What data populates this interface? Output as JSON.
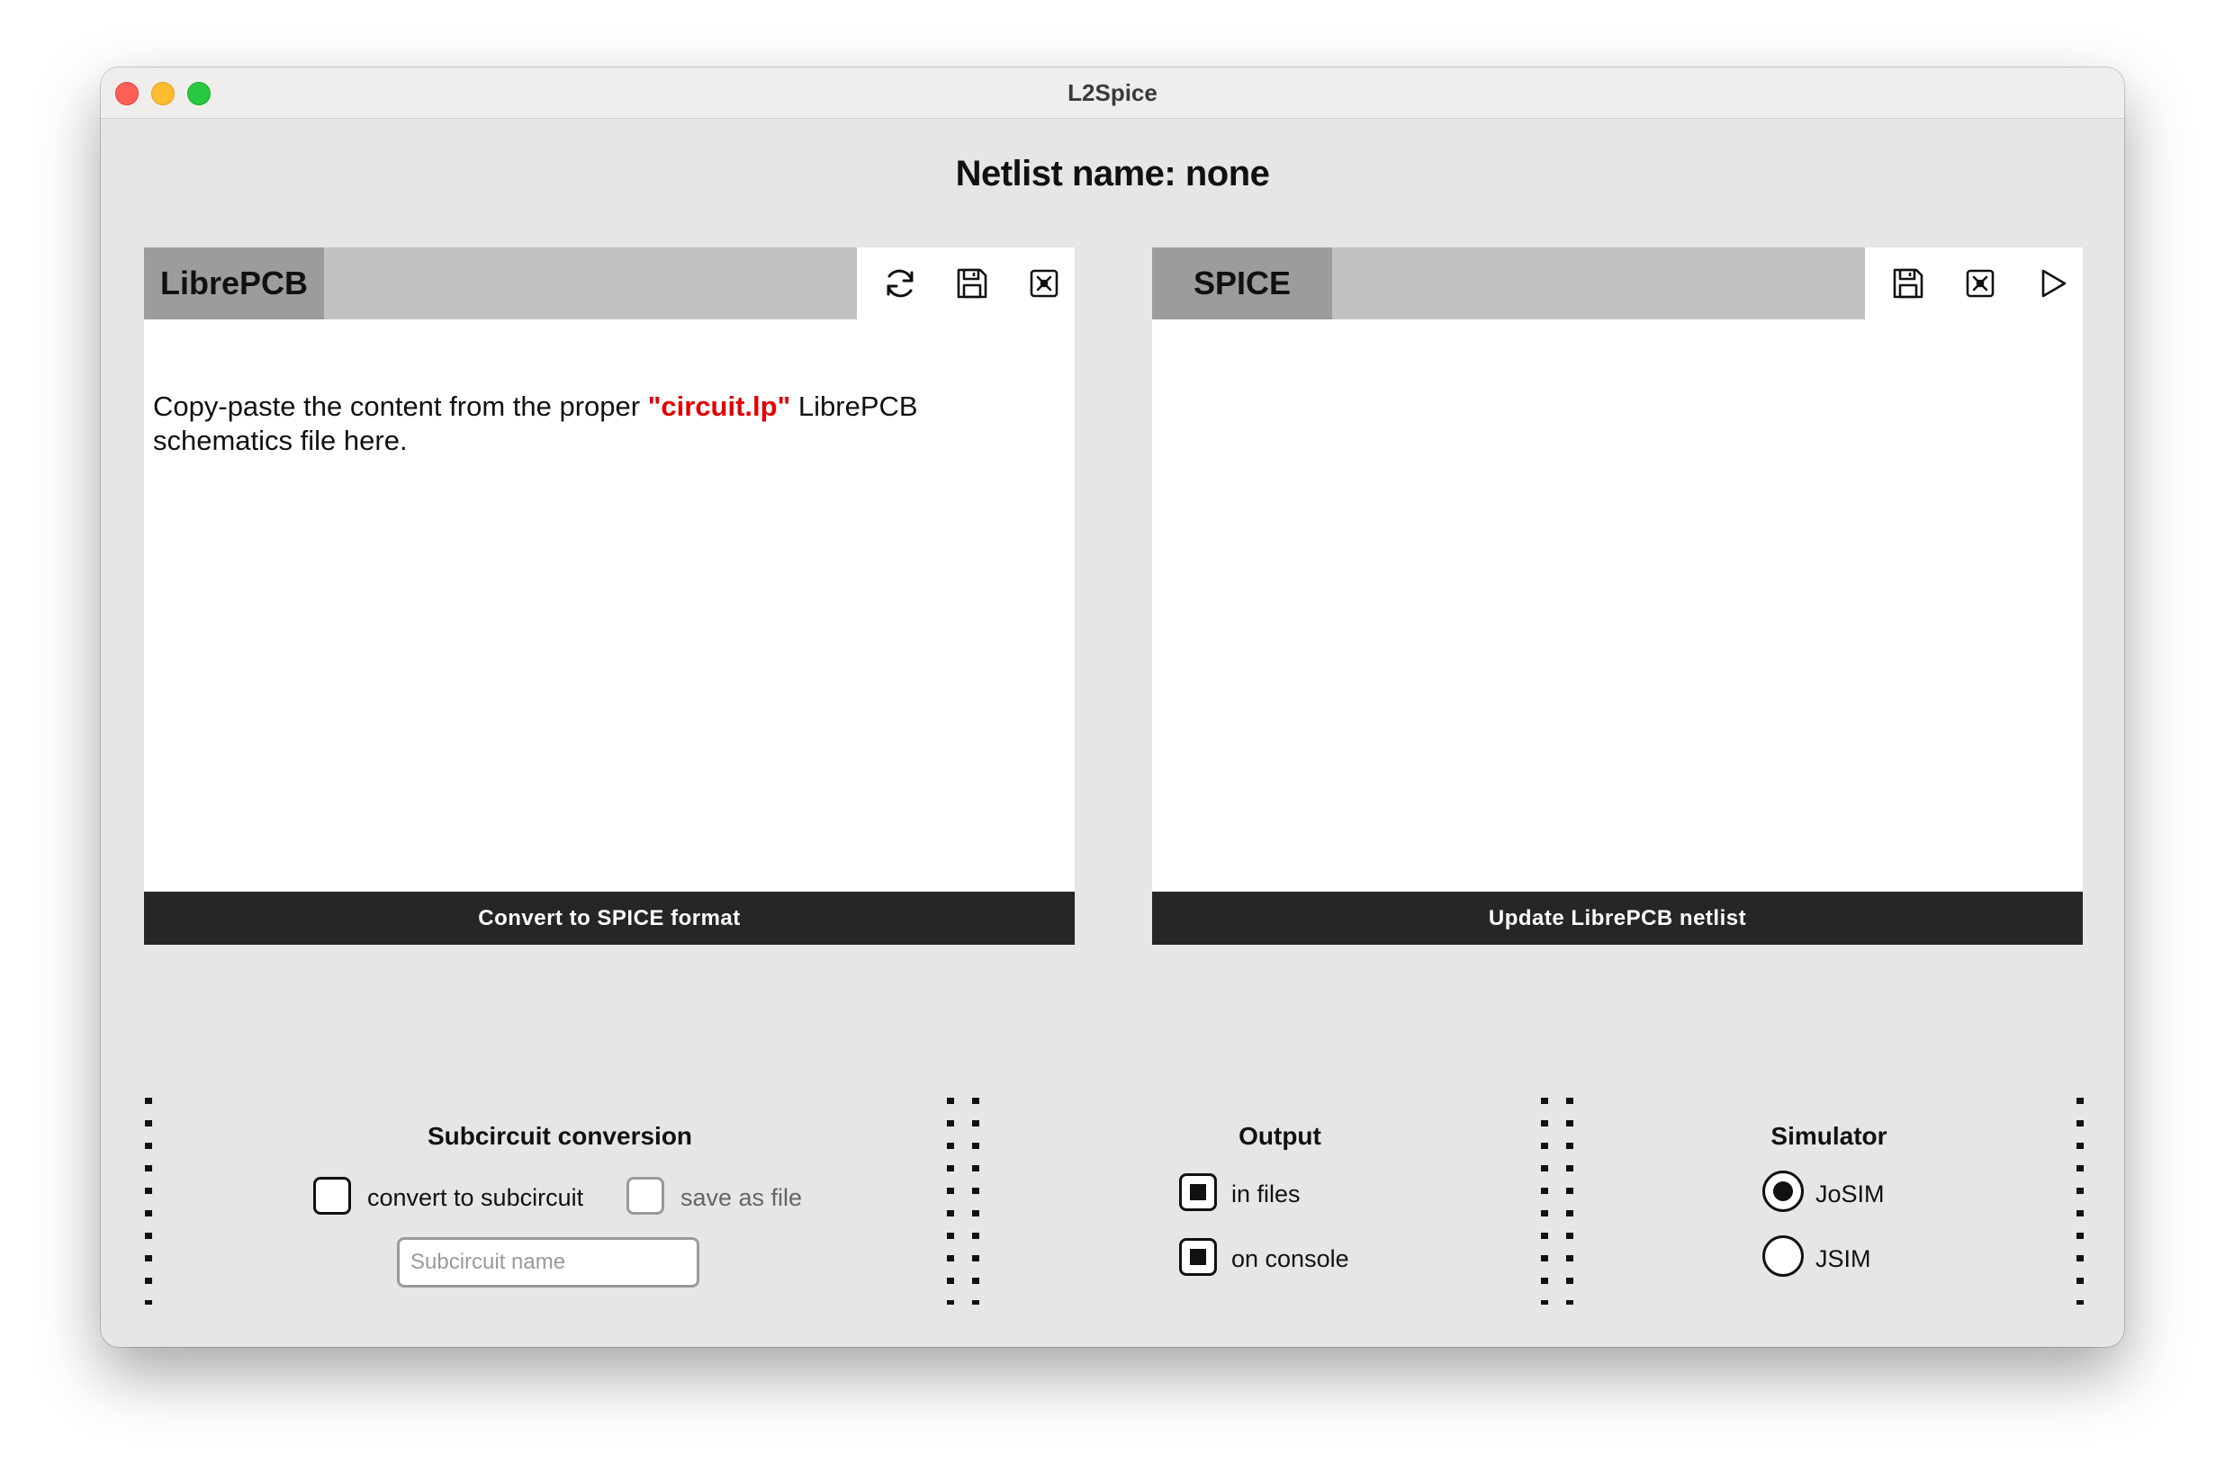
{
  "window": {
    "title": "L2Spice"
  },
  "header": {
    "netlist_label": "Netlist name: none"
  },
  "left_panel": {
    "tab_label": "LibrePCB",
    "tools": [
      "refresh-icon",
      "save-icon",
      "clear-icon"
    ],
    "instruction_before": "Copy-paste the content from the proper ",
    "instruction_highlight": "\"circuit.lp\"",
    "instruction_after": " LibrePCB schematics file here.",
    "button_label": "Convert to SPICE format",
    "highlight_color": "#e00000"
  },
  "right_panel": {
    "tab_label": "SPICE",
    "tools": [
      "save-icon",
      "clear-icon",
      "play-icon"
    ],
    "button_label": "Update LibrePCB netlist"
  },
  "subcircuit": {
    "title": "Subcircuit conversion",
    "convert_label": "convert to subcircuit",
    "convert_checked": false,
    "save_label": "save as file",
    "save_checked": false,
    "save_enabled": false,
    "name_placeholder": "Subcircuit name",
    "name_value": ""
  },
  "output": {
    "title": "Output",
    "in_files_label": "in files",
    "in_files_checked": true,
    "on_console_label": "on console",
    "on_console_checked": true
  },
  "simulator": {
    "title": "Simulator",
    "options": [
      "JoSIM",
      "JSIM"
    ],
    "selected": "JoSIM"
  }
}
